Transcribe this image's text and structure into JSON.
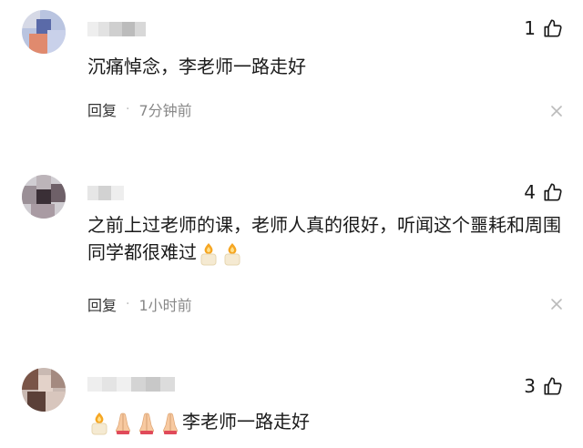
{
  "comments": [
    {
      "likes": "1",
      "text": "沉痛悼念，李老师一路走好",
      "reply_label": "回复",
      "separator": "·",
      "time": "7分钟前"
    },
    {
      "likes": "4",
      "text": "之前上过老师的课，老师人真的很好，听闻这个噩耗和周围同学都很难过",
      "reply_label": "回复",
      "separator": "·",
      "time": "1小时前"
    },
    {
      "likes": "3",
      "text": "李老师一路走好"
    }
  ],
  "icons": {
    "like": "thumbs-up-icon",
    "close": "close-icon",
    "candle": "candle-emoji",
    "pray": "folded-hands-emoji"
  },
  "colors": {
    "text": "#1a1a1a",
    "meta": "#888888",
    "close": "#bbbbbb"
  }
}
